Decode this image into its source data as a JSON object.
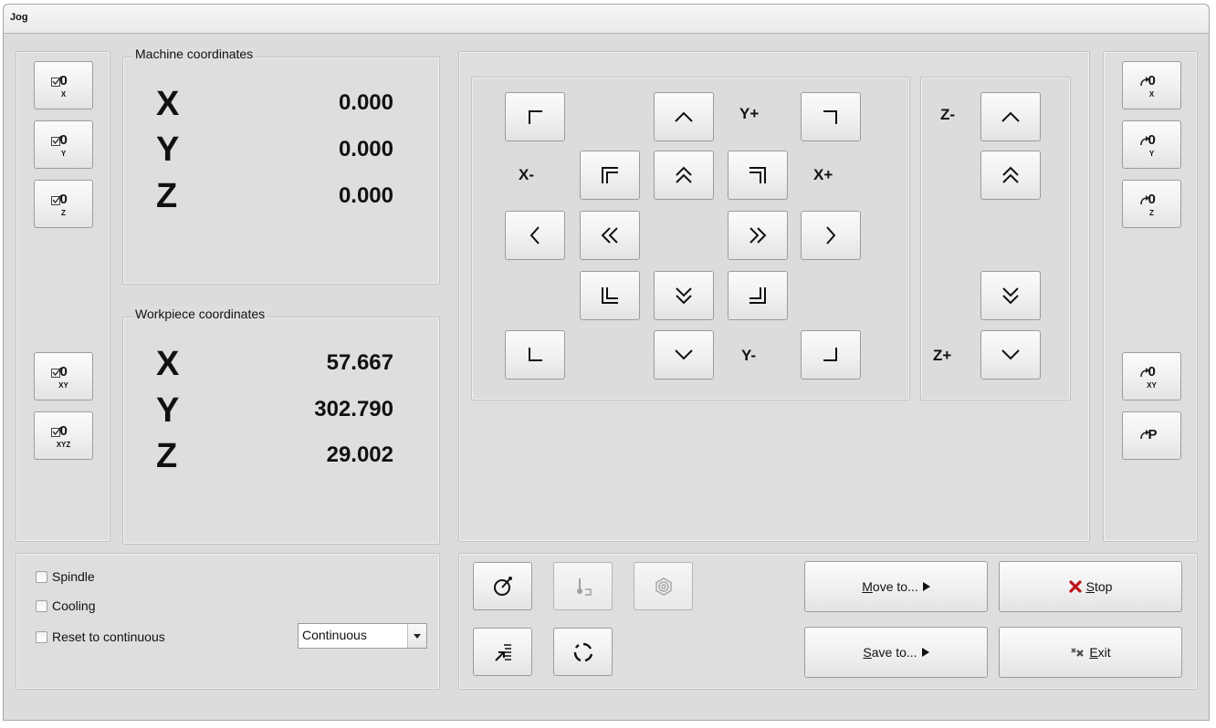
{
  "window": {
    "title": "Jog"
  },
  "machine": {
    "title": "Machine coordinates",
    "axes": [
      {
        "axis": "X",
        "value": "0.000"
      },
      {
        "axis": "Y",
        "value": "0.000"
      },
      {
        "axis": "Z",
        "value": "0.000"
      }
    ]
  },
  "workpiece": {
    "title": "Workpiece coordinates",
    "axes": [
      {
        "axis": "X",
        "value": "57.667"
      },
      {
        "axis": "Y",
        "value": "302.790"
      },
      {
        "axis": "Z",
        "value": "29.002"
      }
    ]
  },
  "zero_buttons": {
    "digit": "0",
    "x": "X",
    "y": "Y",
    "z": "Z",
    "xy": "XY",
    "xyz": "XYZ"
  },
  "goto_buttons": {
    "digit": "0",
    "x": "X",
    "y": "Y",
    "z": "Z",
    "xy": "XY",
    "park": "P"
  },
  "jog_labels": {
    "y_plus": "Y+",
    "y_minus": "Y-",
    "x_minus": "X-",
    "x_plus": "X+",
    "z_minus": "Z-",
    "z_plus": "Z+"
  },
  "options": {
    "spindle": "Spindle",
    "cooling": "Cooling",
    "reset": "Reset to continuous",
    "mode_selected": "Continuous"
  },
  "actions": {
    "move_to": {
      "accel": "M",
      "rest": "ove to..."
    },
    "save_to": {
      "accel": "S",
      "rest": "ave to..."
    },
    "stop": {
      "accel": "S",
      "rest": "top"
    },
    "exit": {
      "accel": "E",
      "rest": "xit"
    }
  },
  "colors": {
    "stop_icon": "#c0141b",
    "window_bg": "#dcdcdc"
  },
  "icons": [
    "probe-icon",
    "tool-length-icon",
    "spiral-icon",
    "align-icon",
    "rotate-icon"
  ]
}
